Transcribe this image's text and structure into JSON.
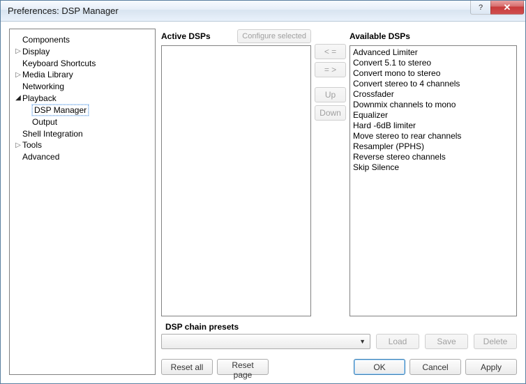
{
  "window": {
    "title": "Preferences: DSP Manager",
    "help_symbol": "?",
    "close_symbol": "✕"
  },
  "sidebar": {
    "items": [
      {
        "label": "Components",
        "expandable": false
      },
      {
        "label": "Display",
        "expandable": true,
        "open": false
      },
      {
        "label": "Keyboard Shortcuts",
        "expandable": false
      },
      {
        "label": "Media Library",
        "expandable": true,
        "open": false
      },
      {
        "label": "Networking",
        "expandable": false
      },
      {
        "label": "Playback",
        "expandable": true,
        "open": true,
        "children": [
          {
            "label": "DSP Manager",
            "selected": true
          },
          {
            "label": "Output"
          }
        ]
      },
      {
        "label": "Shell Integration",
        "expandable": false
      },
      {
        "label": "Tools",
        "expandable": true,
        "open": false
      },
      {
        "label": "Advanced",
        "expandable": false
      }
    ]
  },
  "dsp": {
    "active_header": "Active DSPs",
    "available_header": "Available DSPs",
    "configure_label": "Configure selected",
    "move_left_label": "< =",
    "move_right_label": "= >",
    "up_label": "Up",
    "down_label": "Down",
    "available_items": [
      "Advanced Limiter",
      "Convert 5.1 to stereo",
      "Convert mono to stereo",
      "Convert stereo to 4 channels",
      "Crossfader",
      "Downmix channels to mono",
      "Equalizer",
      "Hard -6dB limiter",
      "Move stereo to rear channels",
      "Resampler (PPHS)",
      "Reverse stereo channels",
      "Skip Silence"
    ]
  },
  "presets": {
    "header": "DSP chain presets",
    "load": "Load",
    "save": "Save",
    "delete": "Delete"
  },
  "buttons": {
    "reset_all": "Reset all",
    "reset_page": "Reset page",
    "ok": "OK",
    "cancel": "Cancel",
    "apply": "Apply"
  }
}
